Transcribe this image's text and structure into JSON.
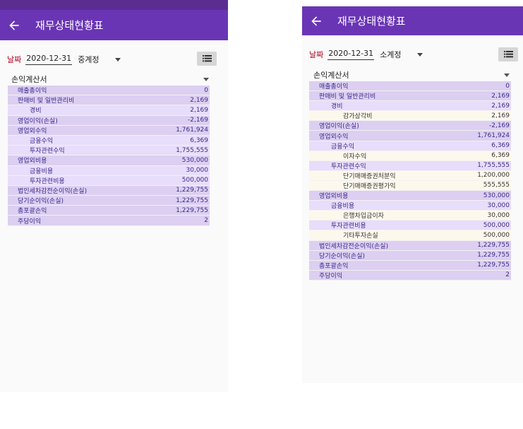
{
  "app": {
    "title": "재무상태현황표"
  },
  "filters": {
    "date_label": "날짜"
  },
  "left": {
    "date": "2020-12-31",
    "level": "중계정",
    "statement": "손익계산서",
    "rows": [
      {
        "name": "매출총이익",
        "value": "0",
        "level": 1
      },
      {
        "name": "판매비 및 일반관리비",
        "value": "2,169",
        "level": 1
      },
      {
        "name": "경비",
        "value": "2,169",
        "level": 2
      },
      {
        "name": "영업이익(손실)",
        "value": "-2,169",
        "level": 1
      },
      {
        "name": "영업외수익",
        "value": "1,761,924",
        "level": 1
      },
      {
        "name": "금융수익",
        "value": "6,369",
        "level": 2
      },
      {
        "name": "투자관련수익",
        "value": "1,755,555",
        "level": 2
      },
      {
        "name": "영업외비용",
        "value": "530,000",
        "level": 1
      },
      {
        "name": "금융비용",
        "value": "30,000",
        "level": 2
      },
      {
        "name": "투자관련비용",
        "value": "500,000",
        "level": 2
      },
      {
        "name": "법인세차감전순이익(손실)",
        "value": "1,229,755",
        "level": 1
      },
      {
        "name": "당기순이익(손실)",
        "value": "1,229,755",
        "level": 1
      },
      {
        "name": "총포괄손익",
        "value": "1,229,755",
        "level": 1
      },
      {
        "name": "주당이익",
        "value": "2",
        "level": 1
      }
    ]
  },
  "right": {
    "date": "2020-12-31",
    "level": "소계정",
    "statement": "손익계산서",
    "rows": [
      {
        "name": "매출총이익",
        "value": "0",
        "level": 1
      },
      {
        "name": "판매비 및 일반관리비",
        "value": "2,169",
        "level": 1
      },
      {
        "name": "경비",
        "value": "2,169",
        "level": 2
      },
      {
        "name": "감가상각비",
        "value": "2,169",
        "level": 3
      },
      {
        "name": "영업이익(손실)",
        "value": "-2,169",
        "level": 1
      },
      {
        "name": "영업외수익",
        "value": "1,761,924",
        "level": 1
      },
      {
        "name": "금융수익",
        "value": "6,369",
        "level": 2
      },
      {
        "name": "이자수익",
        "value": "6,369",
        "level": 3
      },
      {
        "name": "투자관련수익",
        "value": "1,755,555",
        "level": 2
      },
      {
        "name": "단기매매증권처분익",
        "value": "1,200,000",
        "level": 3
      },
      {
        "name": "단기매매증권평가익",
        "value": "555,555",
        "level": 3
      },
      {
        "name": "영업외비용",
        "value": "530,000",
        "level": 1
      },
      {
        "name": "금융비용",
        "value": "30,000",
        "level": 2
      },
      {
        "name": "은행차입금이자",
        "value": "30,000",
        "level": 3
      },
      {
        "name": "투자관련비용",
        "value": "500,000",
        "level": 2
      },
      {
        "name": "기타투자손실",
        "value": "500,000",
        "level": 3
      },
      {
        "name": "법인세차감전순이익(손실)",
        "value": "1,229,755",
        "level": 1
      },
      {
        "name": "당기순이익(손실)",
        "value": "1,229,755",
        "level": 1
      },
      {
        "name": "총포괄손익",
        "value": "1,229,755",
        "level": 1
      },
      {
        "name": "주당이익",
        "value": "2",
        "level": 1
      }
    ]
  }
}
